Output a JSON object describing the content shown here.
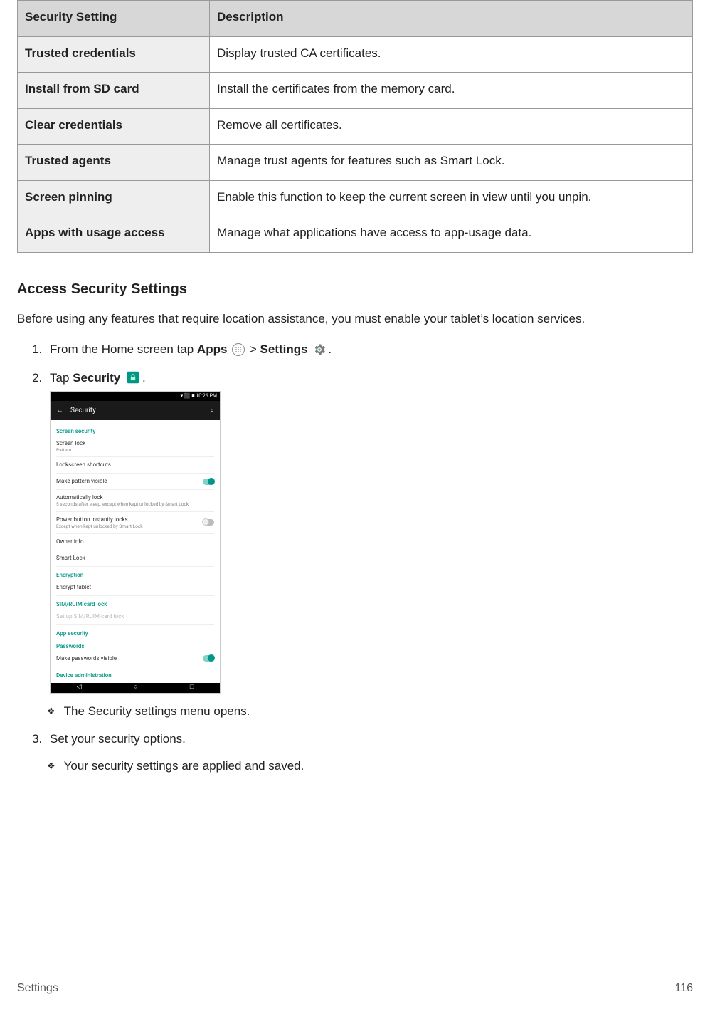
{
  "table": {
    "headers": [
      "Security Setting",
      "Description"
    ],
    "rows": [
      {
        "name": "Trusted credentials",
        "desc": "Display trusted CA certificates."
      },
      {
        "name": "Install from SD card",
        "desc": "Install the certificates from the memory card."
      },
      {
        "name": "Clear credentials",
        "desc": "Remove all certificates."
      },
      {
        "name": "Trusted agents",
        "desc": "Manage trust agents for features such as Smart Lock."
      },
      {
        "name": "Screen pinning",
        "desc": "Enable this function to keep the current screen in view until you unpin."
      },
      {
        "name": "Apps with usage access",
        "desc": "Manage what applications have access to app-usage data."
      }
    ]
  },
  "section_title": "Access Security Settings",
  "intro": "Before using any features that require location assistance, you must enable your tablet’s location services.",
  "step1": {
    "prefix": "From the Home screen tap ",
    "apps": "Apps",
    "gt": " > ",
    "settings": "Settings",
    "suffix": "."
  },
  "step2": {
    "prefix": "Tap ",
    "security": "Security",
    "suffix": "."
  },
  "step2_result": "The Security settings menu opens.",
  "step3": "Set your security options.",
  "step3_result": "Your security settings are applied and saved.",
  "screenshot": {
    "status_time": "▾ ⬛ ■ 10:26 PM",
    "back_arrow": "←",
    "appbar_title": "Security",
    "search_glyph": "⌕",
    "cat_screen_security": "Screen security",
    "screen_lock": {
      "title": "Screen lock",
      "sub": "Pattern"
    },
    "lockscreen_shortcuts": "Lockscreen shortcuts",
    "make_pattern_visible": "Make pattern visible",
    "auto_lock": {
      "title": "Automatically lock",
      "sub": "5 seconds after sleep, except when kept unlocked by Smart Lock"
    },
    "power_button": {
      "title": "Power button instantly locks",
      "sub": "Except when kept unlocked by Smart Lock"
    },
    "owner_info": "Owner info",
    "smart_lock": "Smart Lock",
    "cat_encryption": "Encryption",
    "encrypt_tablet": "Encrypt tablet",
    "cat_sim": "SIM/RUIM card lock",
    "setup_sim": "Set up SIM/RUIM card lock",
    "cat_app": "App security",
    "cat_passwords": "Passwords",
    "make_pw_visible": "Make passwords visible",
    "cat_device_admin": "Device administration",
    "nav_back": "◁",
    "nav_home": "○",
    "nav_recent": "□"
  },
  "footer": {
    "left": "Settings",
    "right": "116"
  }
}
